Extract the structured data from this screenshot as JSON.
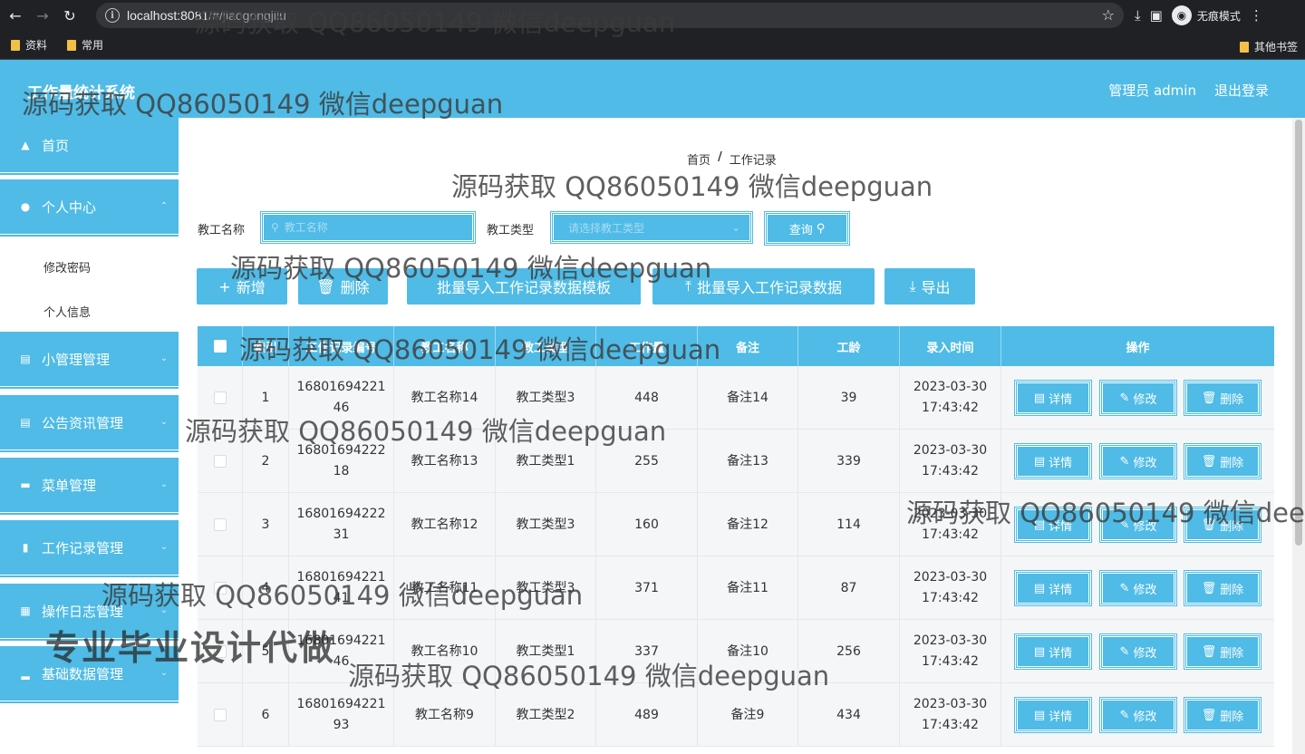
{
  "browser": {
    "url_host": "localhost:8081",
    "url_path": "/#/jiaogongjilu",
    "incognito_label": "无痕模式",
    "bookmarks": [
      "资料",
      "常用"
    ],
    "other_bookmarks": "其他书签"
  },
  "header": {
    "title": "工作量统计系统",
    "user": "管理员 admin",
    "logout": "退出登录"
  },
  "sidebar": {
    "items": [
      {
        "label": "首页",
        "icon": "home-icon"
      },
      {
        "label": "个人中心",
        "icon": "user-icon"
      },
      {
        "label": "小管理管理",
        "icon": "inbox-icon"
      },
      {
        "label": "公告资讯管理",
        "icon": "clipboard-icon"
      },
      {
        "label": "菜单管理",
        "icon": "monitor-icon"
      },
      {
        "label": "工作记录管理",
        "icon": "comment-icon"
      },
      {
        "label": "操作日志管理",
        "icon": "grid-icon"
      },
      {
        "label": "基础数据管理",
        "icon": "bar-chart-icon"
      }
    ],
    "sub_items": [
      "修改密码",
      "个人信息"
    ]
  },
  "breadcrumb": {
    "home": "首页",
    "sep": "/",
    "current": "工作记录"
  },
  "search": {
    "name_label": "教工名称",
    "name_placeholder": "教工名称",
    "type_label": "教工类型",
    "type_placeholder": "请选择教工类型",
    "query_label": "查询"
  },
  "actions": {
    "add": "新增",
    "delete": "删除",
    "template": "批量导入工作记录数据模板",
    "import": "批量导入工作记录数据",
    "export": "导出"
  },
  "table": {
    "columns": [
      "",
      "索引",
      "工作记录编号",
      "教工名称",
      "教工类型",
      "工作量",
      "备注",
      "工龄",
      "录入时间",
      "操作"
    ],
    "rows": [
      {
        "index": "1",
        "no1": "16801694221",
        "no2": "46",
        "name": "教工名称14",
        "type": "教工类型3",
        "workload": "448",
        "remark": "备注14",
        "years": "39",
        "date": "2023-03-30",
        "time": "17:43:42"
      },
      {
        "index": "2",
        "no1": "16801694222",
        "no2": "18",
        "name": "教工名称13",
        "type": "教工类型1",
        "workload": "255",
        "remark": "备注13",
        "years": "339",
        "date": "2023-03-30",
        "time": "17:43:42"
      },
      {
        "index": "3",
        "no1": "16801694222",
        "no2": "31",
        "name": "教工名称12",
        "type": "教工类型3",
        "workload": "160",
        "remark": "备注12",
        "years": "114",
        "date": "2023-03-30",
        "time": "17:43:42"
      },
      {
        "index": "4",
        "no1": "16801694221",
        "no2": "41",
        "name": "教工名称11",
        "type": "教工类型3",
        "workload": "371",
        "remark": "备注11",
        "years": "87",
        "date": "2023-03-30",
        "time": "17:43:42"
      },
      {
        "index": "5",
        "no1": "16801694221",
        "no2": "46",
        "name": "教工名称10",
        "type": "教工类型1",
        "workload": "337",
        "remark": "备注10",
        "years": "256",
        "date": "2023-03-30",
        "time": "17:43:42"
      },
      {
        "index": "6",
        "no1": "16801694221",
        "no2": "93",
        "name": "教工名称9",
        "type": "教工类型2",
        "workload": "489",
        "remark": "备注9",
        "years": "434",
        "date": "2023-03-30",
        "time": "17:43:42"
      }
    ],
    "op_labels": {
      "detail": "详情",
      "edit": "修改",
      "delete": "删除"
    }
  },
  "watermark": {
    "text": "源码获取 QQ86050149 微信deepguan",
    "big_text": "专业毕业设计代做"
  },
  "colors": {
    "primary": "#4fbbe6",
    "chrome": "#202124"
  }
}
